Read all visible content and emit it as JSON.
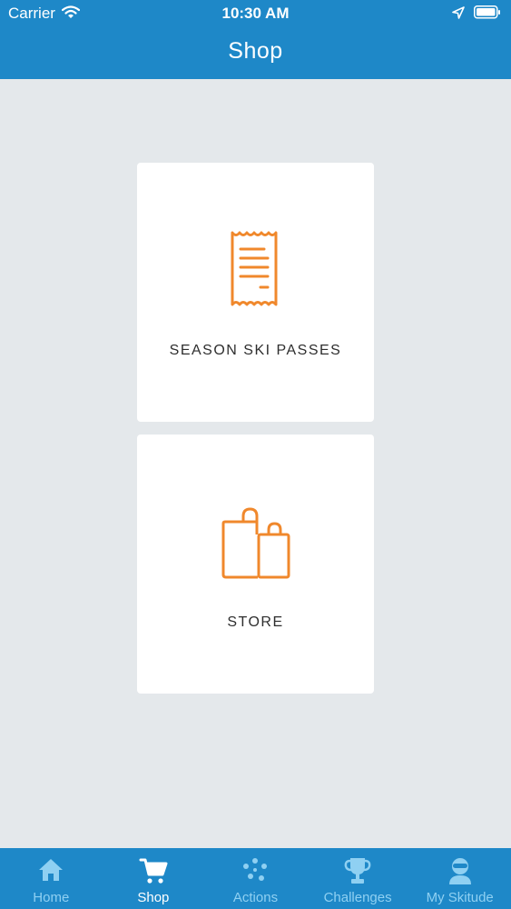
{
  "status_bar": {
    "carrier": "Carrier",
    "time": "10:30 AM"
  },
  "header": {
    "title": "Shop"
  },
  "cards": [
    {
      "label": "SEASON SKI PASSES",
      "icon": "receipt-icon"
    },
    {
      "label": "STORE",
      "icon": "shopping-bags-icon"
    }
  ],
  "tabs": [
    {
      "label": "Home",
      "icon": "home-icon",
      "active": false
    },
    {
      "label": "Shop",
      "icon": "cart-icon",
      "active": true
    },
    {
      "label": "Actions",
      "icon": "dots-icon",
      "active": false
    },
    {
      "label": "Challenges",
      "icon": "trophy-icon",
      "active": false
    },
    {
      "label": "My Skitude",
      "icon": "skier-icon",
      "active": false
    }
  ],
  "colors": {
    "primary": "#1e88c8",
    "accent": "#f0882c",
    "background": "#e4e8eb",
    "tab_inactive": "#8fd0f2"
  }
}
